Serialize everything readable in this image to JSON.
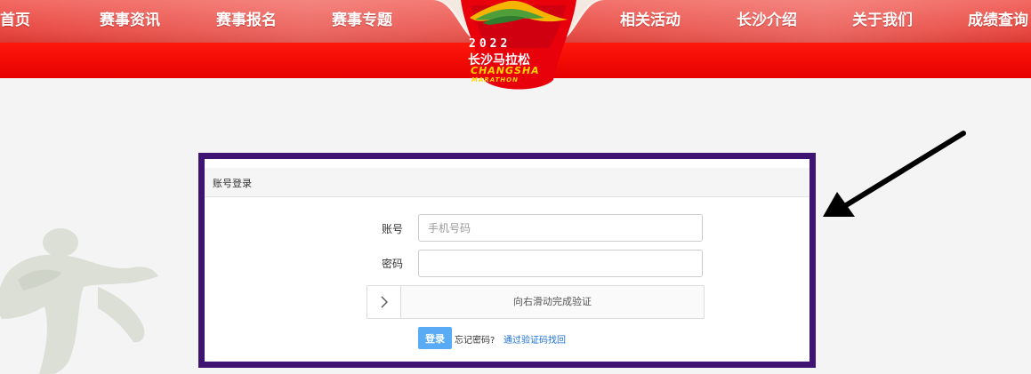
{
  "nav": {
    "items": [
      {
        "id": "home",
        "label": "首页"
      },
      {
        "id": "news",
        "label": "赛事资讯"
      },
      {
        "id": "register",
        "label": "赛事报名"
      },
      {
        "id": "topics",
        "label": "赛事专题"
      },
      {
        "id": "activities",
        "label": "相关活动"
      },
      {
        "id": "changsha",
        "label": "长沙介绍"
      },
      {
        "id": "about",
        "label": "关于我们"
      },
      {
        "id": "results",
        "label": "成绩查询"
      }
    ]
  },
  "logo": {
    "year": "2022",
    "name_cn": "长沙马拉松",
    "name_en": "CHANGSHA",
    "subtitle_en": "MARATHON"
  },
  "login": {
    "title": "账号登录",
    "account_label": "账号",
    "account_placeholder": "手机号码",
    "account_value": "",
    "password_label": "密码",
    "password_value": "",
    "slider_icon": "chevron-right-icon",
    "slider_text": "向右滑动完成验证",
    "login_button": "登录",
    "forgot_text": "忘记密码?",
    "reset_link": "通过验证码找回"
  },
  "colors": {
    "header_red": "#e60000",
    "nav_band": "#e84a43",
    "frame_border": "#3f1372",
    "login_button": "#5aabf5",
    "link": "#1a6fd6",
    "logo_yellow": "#ffd400"
  }
}
